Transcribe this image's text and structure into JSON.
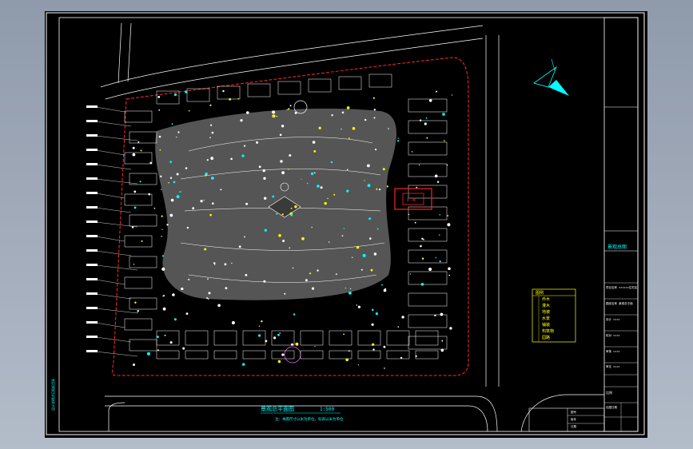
{
  "app": {
    "background_color": "#a2acbb",
    "drawing_background": "#000000"
  },
  "colors": {
    "frame": "#ffffff",
    "boundary": "#ff2a2a",
    "building": "#ffffff",
    "landscape_fill": "#5e5e5e",
    "label": "#ffffff",
    "accent": "#00ffff",
    "highlight": "#ff2222",
    "legend": "#ffff00"
  },
  "north_arrow": {
    "icon": "north-arrow-icon",
    "color": "#00ffff"
  },
  "highlight_box": {
    "label": "E.B"
  },
  "title_block": {
    "project_name": "景观总图",
    "rows": [
      "项目名称 ××××××住宅区",
      "图纸名称 景观总平面",
      "设计 ××××",
      "校对 ××××",
      "审核 ××××",
      "审定 ××××"
    ],
    "bottom_left": "比例",
    "bottom_right": "出图日期",
    "sheet_labels": [
      "图号",
      "版本",
      "日期"
    ]
  },
  "legend": {
    "title": "图例",
    "rows": [
      "乔木",
      "灌木",
      "地被",
      "水景",
      "铺装",
      "构筑物",
      "园路"
    ]
  },
  "plan_title": {
    "main": "景观总平面图",
    "scale": "1:500",
    "note": "注：本图尺寸以米为单位，标高以米为单位"
  },
  "side_note": "设计说明详见图纸目录"
}
